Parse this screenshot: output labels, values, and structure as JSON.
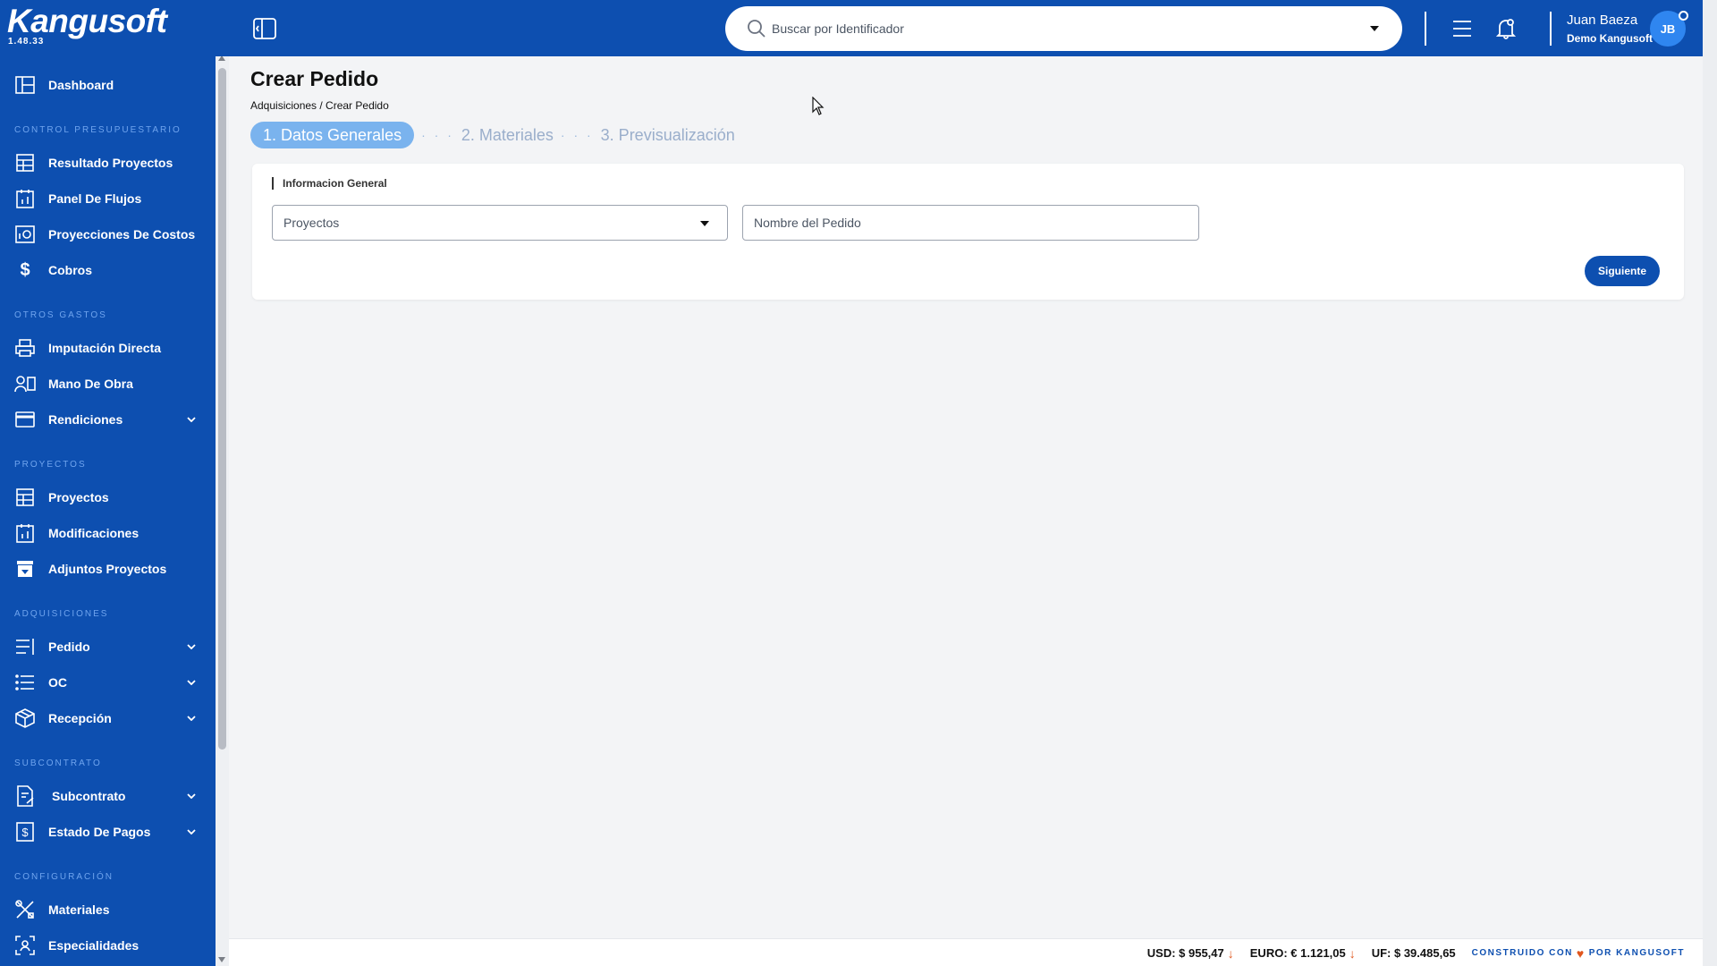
{
  "app": {
    "logo": "Kangusoft",
    "version": "1.48.33"
  },
  "sidebar": {
    "dashboard": "Dashboard",
    "sections": {
      "control": "Control Presupuestario",
      "otros": "Otros Gastos",
      "proyectos": "Proyectos",
      "adquisiciones": "Adquisiciones",
      "subcontrato": "Subcontrato",
      "configuracion": "Configuración"
    },
    "items": {
      "resultado_proyectos": "Resultado Proyectos",
      "panel_flujos": "Panel De Flujos",
      "proyecciones_costos": "Proyecciones De Costos",
      "cobros": "Cobros",
      "imputacion_directa": "Imputación Directa",
      "mano_obra": "Mano De Obra",
      "rendiciones": "Rendiciones",
      "proyectos": "Proyectos",
      "modificaciones": "Modificaciones",
      "adjuntos_proyectos": "Adjuntos Proyectos",
      "pedido": "Pedido",
      "oc": "OC",
      "recepcion": "Recepción",
      "subcontrato": "Subcontrato",
      "estado_pagos": "Estado De Pagos",
      "materiales": "Materiales",
      "especialidades": "Especialidades"
    }
  },
  "header": {
    "search_placeholder": "Buscar por Identificador",
    "user_name": "Juan Baeza",
    "user_org": "Demo Kangusoft",
    "avatar_initials": "JB"
  },
  "page": {
    "title": "Crear Pedido",
    "breadcrumb": "Adquisiciones / Crear Pedido",
    "steps": {
      "step1": "1. Datos Generales",
      "step2": "2. Materiales",
      "step3": "3. Previsualización",
      "dots": "· · ·"
    },
    "card": {
      "title": "Informacion General",
      "proyectos_placeholder": "Proyectos",
      "nombre_placeholder": "Nombre del Pedido",
      "next_button": "Siguiente"
    }
  },
  "footer": {
    "usd": "USD: $ 955,47",
    "euro": "EURO: € 1.121,05",
    "uf": "UF: $ 39.485,65",
    "built_prefix": "CONSTRUIDO CON",
    "built_suffix": "POR KANGUSOFT"
  },
  "colors": {
    "brand_blue": "#0d4fb0",
    "step_active": "#7ab3ee",
    "arrow_down": "#e0561d"
  }
}
